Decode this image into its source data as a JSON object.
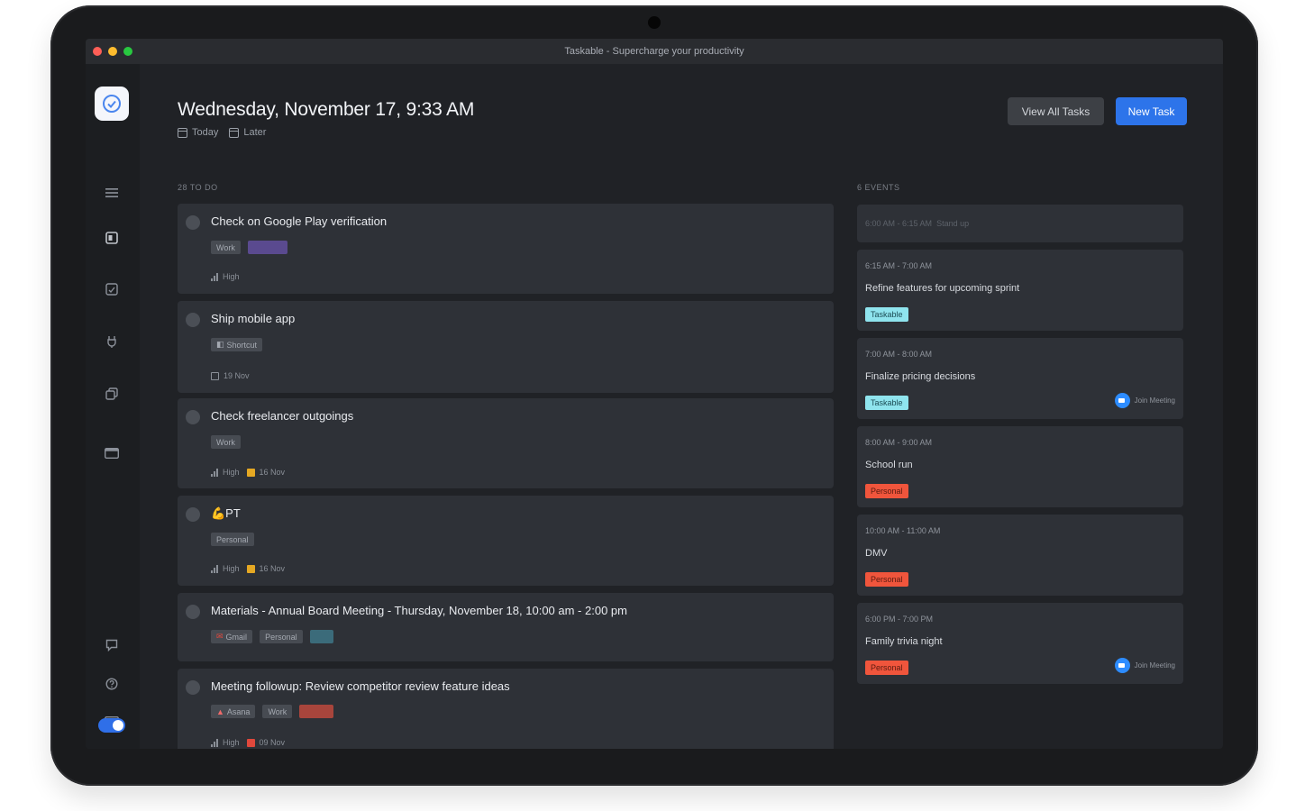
{
  "window": {
    "title": "Taskable - Supercharge your productivity"
  },
  "header": {
    "title": "Wednesday, November 17, 9:33 AM",
    "nav": [
      {
        "label": "Today",
        "icon": "calendar-icon"
      },
      {
        "label": "Later",
        "icon": "calendar-icon"
      }
    ],
    "view_all_label": "View All Tasks",
    "new_task_label": "New Task"
  },
  "sidebar": {
    "icons": [
      "app-logo-icon",
      "menu-icon",
      "inbox-icon",
      "checklist-icon",
      "plug-icon",
      "copy-icon",
      "calendar-grid-icon",
      "chat-icon",
      "help-icon",
      "keyboard-icon",
      "theme-toggle"
    ]
  },
  "todo": {
    "label": "28 TO DO",
    "tasks": [
      {
        "title": "Check on Google Play verification",
        "tags": [
          "Work"
        ],
        "meta_priority": "High",
        "meta_date": ""
      },
      {
        "title": "Ship mobile app",
        "tags": [
          "Shortcut"
        ],
        "meta_priority": "",
        "meta_date": "19 Nov"
      },
      {
        "title": "Check freelancer outgoings",
        "tags": [
          "Work"
        ],
        "meta_priority": "High",
        "meta_date": "16 Nov"
      },
      {
        "title": "💪PT",
        "tags": [
          "Personal"
        ],
        "meta_priority": "High",
        "meta_date": "16 Nov"
      },
      {
        "title": "Materials - Annual Board Meeting - Thursday, November 18, 10:00 am - 2:00 pm",
        "tags": [
          "Gmail",
          "Personal"
        ],
        "meta_priority": "",
        "meta_date": ""
      },
      {
        "title": "Meeting followup: Review competitor review feature ideas",
        "tags": [
          "Asana",
          "Work"
        ],
        "meta_priority": "High",
        "meta_date": "09 Nov"
      }
    ]
  },
  "events": {
    "label": "6 EVENTS",
    "items": [
      {
        "time": "6:00 AM - 6:15 AM",
        "title": "Stand up",
        "tag": ""
      },
      {
        "time": "6:15 AM - 7:00 AM",
        "title": "Refine features for upcoming sprint",
        "tag": "Taskable"
      },
      {
        "time": "7:00 AM - 8:00 AM",
        "title": "Finalize pricing decisions",
        "tag": "Taskable",
        "join": "Join Meeting"
      },
      {
        "time": "8:00 AM - 9:00 AM",
        "title": "School run",
        "tag": "Personal"
      },
      {
        "time": "10:00 AM - 11:00 AM",
        "title": "DMV",
        "tag": "Personal"
      },
      {
        "time": "6:00 PM - 7:00 PM",
        "title": "Family trivia night",
        "tag": "Personal",
        "join": "Join Meeting"
      }
    ]
  },
  "colors": {
    "accent": "#2d74ea",
    "taskable_tag": "#8fe4ee",
    "personal_tag": "#f0553c",
    "background": "#202226"
  }
}
